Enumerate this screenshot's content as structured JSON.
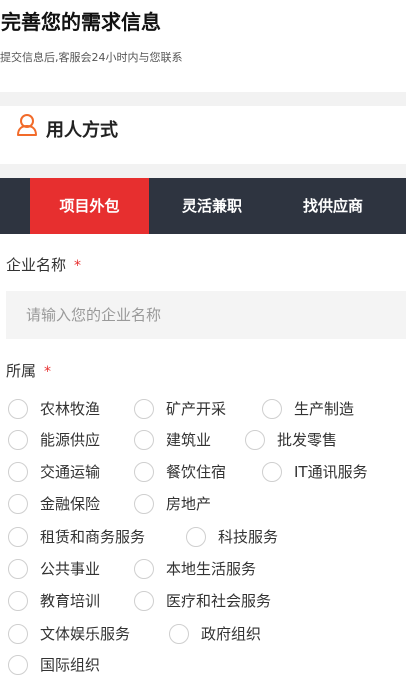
{
  "header": {
    "title": "完善您的需求信息",
    "subtitle": "提交信息后,客服会24小时内与您联系"
  },
  "section": {
    "title": "用人方式",
    "icon": "user-icon",
    "accent_color": "#f26b2a"
  },
  "tabs": [
    {
      "label": "项目外包",
      "active": true
    },
    {
      "label": "灵活兼职",
      "active": false
    },
    {
      "label": "找供应商",
      "active": false
    }
  ],
  "company_field": {
    "label": "企业名称",
    "required_mark": "*",
    "placeholder": "请输入您的企业名称",
    "value": ""
  },
  "industry_field": {
    "label": "所属",
    "required_mark": "*",
    "options": [
      "农林牧渔",
      "矿产开采",
      "生产制造",
      "能源供应",
      "建筑业",
      "批发零售",
      "交通运输",
      "餐饮住宿",
      "IT通讯服务",
      "金融保险",
      "房地产",
      "租赁和商务服务",
      "科技服务",
      "公共事业",
      "本地生活服务",
      "教育培训",
      "医疗和社会服务",
      "文体娱乐服务",
      "政府组织",
      "国际组织"
    ]
  },
  "colors": {
    "tab_bar": "#2e3440",
    "tab_active": "#e72f2f",
    "required": "#e72f2f"
  }
}
